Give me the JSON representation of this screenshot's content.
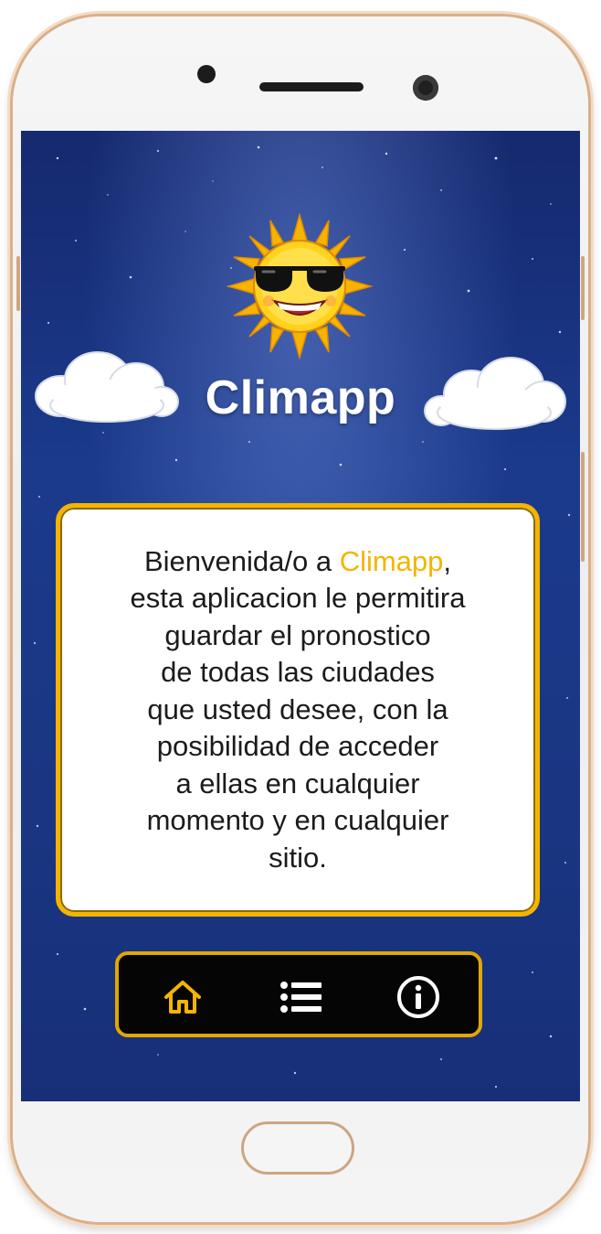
{
  "app": {
    "title": "Climapp",
    "logo_icon": "sun-with-sunglasses-icon"
  },
  "welcome": {
    "prefix": "Bienvenida/o a ",
    "app_name": "Climapp",
    "comma": ",",
    "lines": [
      "esta aplicacion le permitira",
      "guardar el pronostico",
      "de todas las ciudades",
      "que usted desee, con la",
      "posibilidad de acceder",
      "a ellas en cualquier",
      "momento y en cualquier",
      "sitio."
    ]
  },
  "nav": {
    "items": [
      {
        "icon": "home-icon",
        "active": true
      },
      {
        "icon": "list-icon",
        "active": false
      },
      {
        "icon": "info-icon",
        "active": false
      }
    ]
  },
  "colors": {
    "accent": "#f5b400",
    "background": "#1b3a8c",
    "card": "#ffffff",
    "nav_background": "#050505",
    "frame_gold": "#d9b08a"
  }
}
